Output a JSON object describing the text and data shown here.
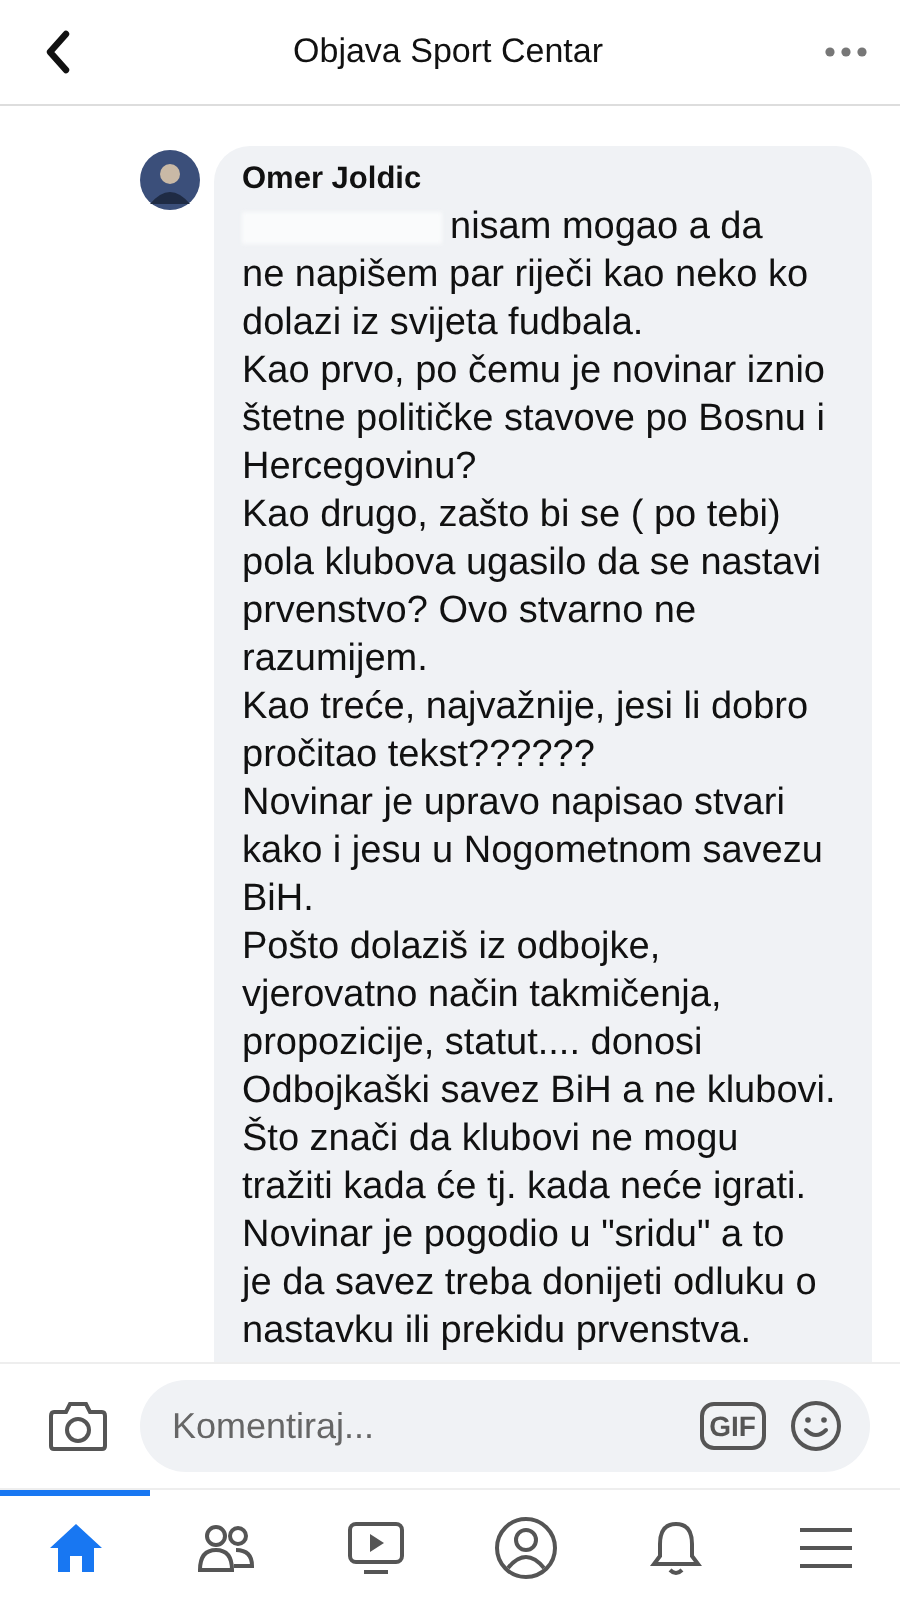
{
  "header": {
    "title": "Objava Sport Centar"
  },
  "comment": {
    "author": "Omer Joldic",
    "redacted_start": true,
    "paragraphs": [
      {
        "lines": [
          "nisam mogao a da",
          "ne napišem par riječi kao neko ko",
          "dolazi iz svijeta fudbala."
        ]
      },
      {
        "lines": [
          "Kao prvo, po čemu je novinar iznio",
          "štetne političke stavove po Bosnu i",
          "Hercegovinu?"
        ]
      },
      {
        "lines": [
          "Kao drugo, zašto bi se ( po tebi)",
          "pola klubova ugasilo da se nastavi",
          "prvenstvo? Ovo stvarno ne",
          "razumijem."
        ]
      },
      {
        "lines": [
          "Kao treće, najvažnije, jesi li dobro",
          "pročitao tekst??????"
        ]
      },
      {
        "lines": [
          "Novinar je upravo napisao stvari",
          "kako i jesu u Nogometnom savezu",
          "BiH."
        ]
      },
      {
        "lines": [
          "Pošto dolaziš iz odbojke,",
          "vjerovatno način takmičenja,",
          "propozicije, statut.... donosi",
          "Odbojkaški savez BiH a ne klubovi.",
          "Što znači da klubovi ne mogu",
          "tražiti kada će tj. kada neće igrati.",
          "Novinar je pogodio u \"sridu\"  a to",
          "je da savez treba donijeti odluku o",
          "nastavku ili prekidu prvenstva."
        ]
      }
    ]
  },
  "composer": {
    "placeholder": "Komentiraj...",
    "gif": "GIF"
  },
  "tabs": [
    {
      "kind": "home",
      "selected": true
    },
    {
      "kind": "friends",
      "selected": false
    },
    {
      "kind": "watch",
      "selected": false
    },
    {
      "kind": "profile",
      "selected": false
    },
    {
      "kind": "bell",
      "selected": false
    },
    {
      "kind": "menu",
      "selected": false
    }
  ]
}
